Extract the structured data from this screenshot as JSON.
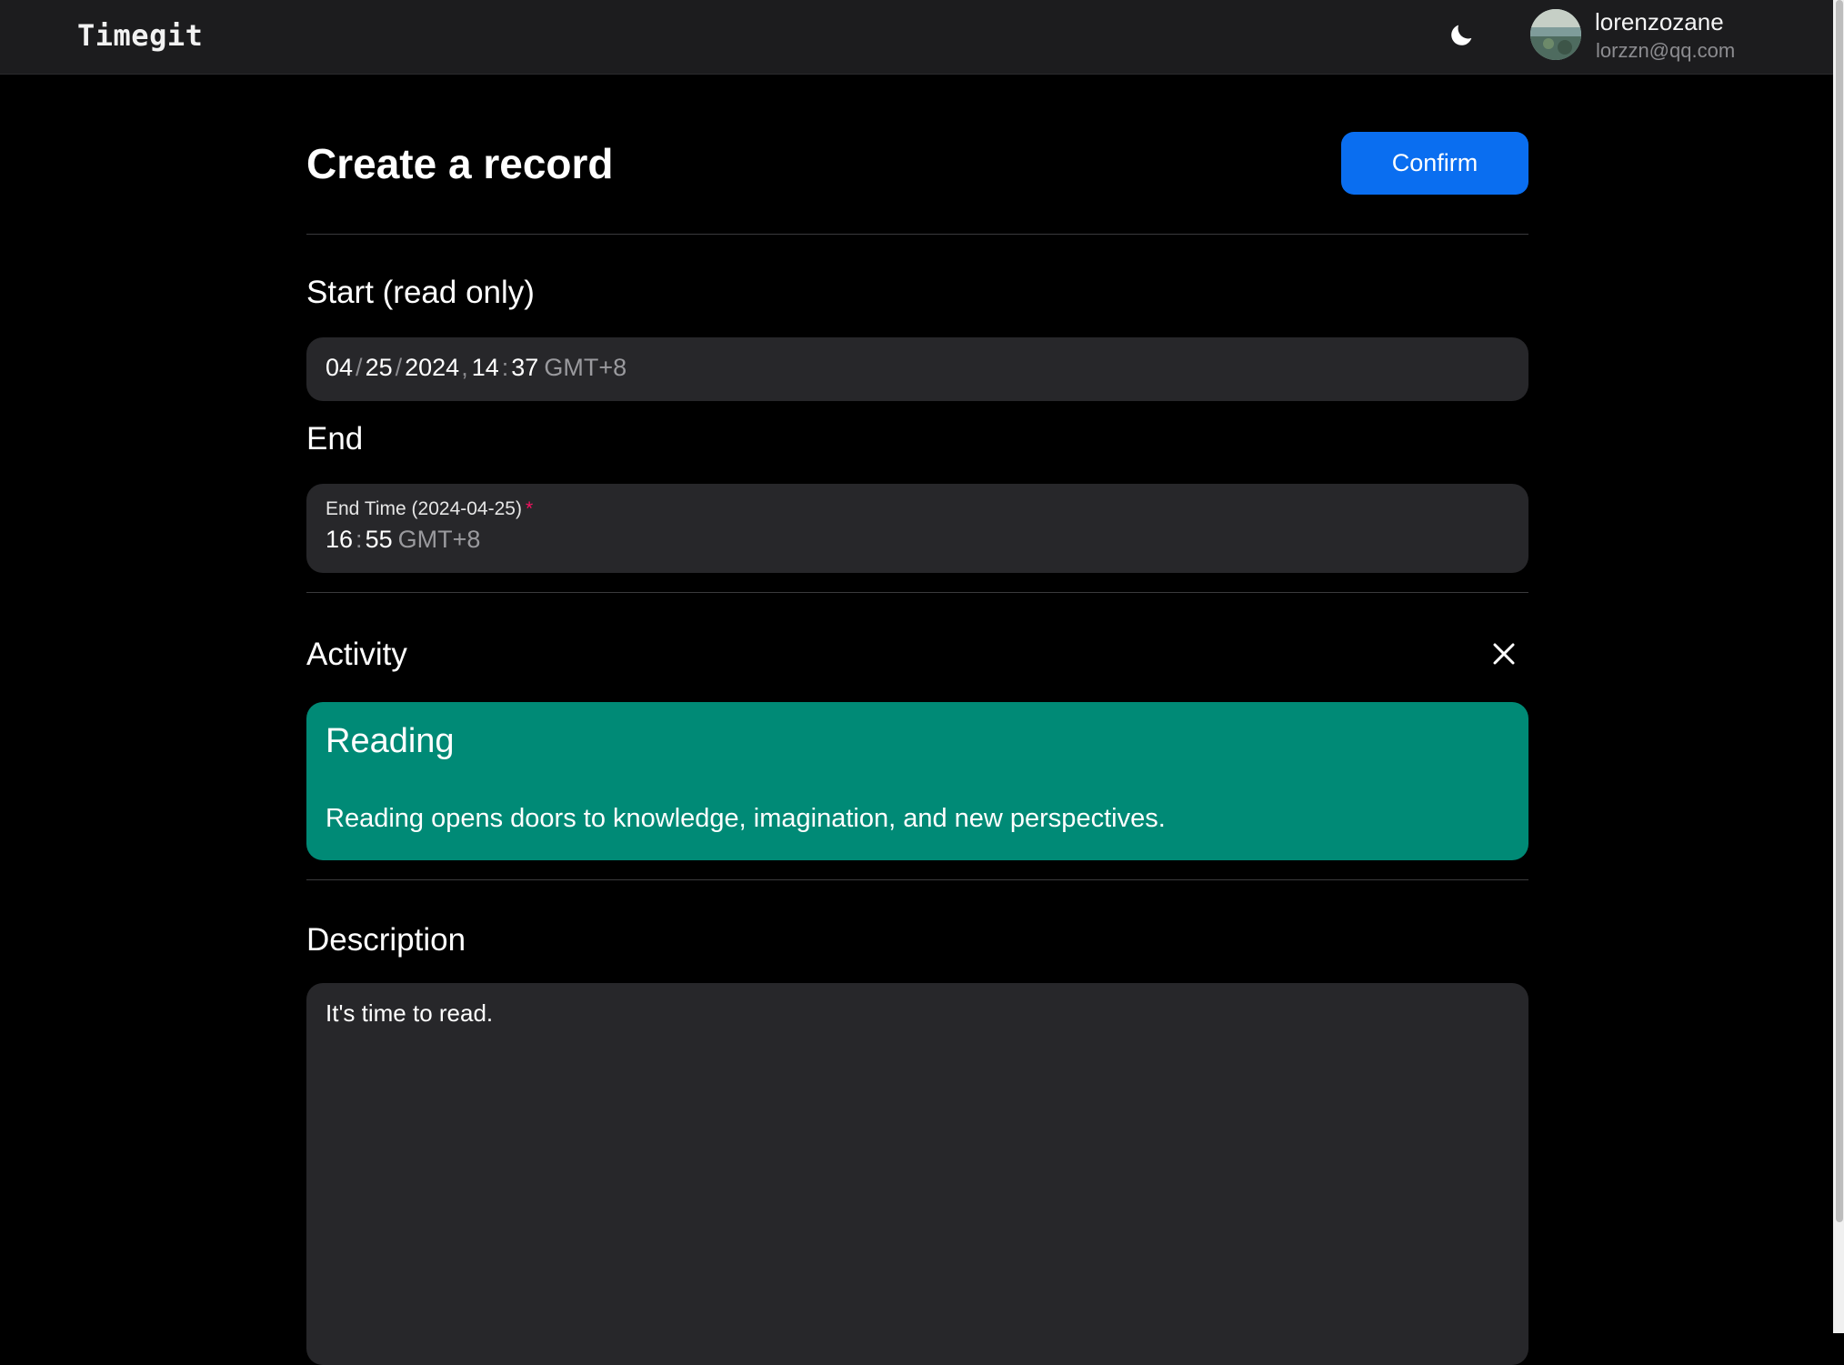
{
  "app": {
    "logo": "Timegit"
  },
  "header": {
    "theme_icon": "moon-icon",
    "user": {
      "name": "lorenzozane",
      "email": "lorzzn@qq.com"
    }
  },
  "form": {
    "title": "Create a record",
    "confirm_label": "Confirm",
    "start": {
      "label": "Start (read only)",
      "month": "04",
      "day": "25",
      "year": "2024",
      "hour": "14",
      "minute": "37",
      "date_sep": "/",
      "comma": ",",
      "time_sep": ":",
      "timezone": "GMT+8"
    },
    "end": {
      "label": "End",
      "caption": "End Time (2024-04-25)",
      "required_mark": "*",
      "hour": "16",
      "minute": "55",
      "time_sep": ":",
      "timezone": "GMT+8"
    },
    "activity": {
      "label": "Activity",
      "clear_icon": "close-icon",
      "selected": {
        "name": "Reading",
        "description": "Reading opens doors to knowledge, imagination, and new perspectives.",
        "color": "#008a76"
      }
    },
    "description": {
      "label": "Description",
      "value": "It's time to read."
    }
  },
  "colors": {
    "accent": "#0a6ef0",
    "required": "#f31260",
    "activity": "#008a76"
  }
}
